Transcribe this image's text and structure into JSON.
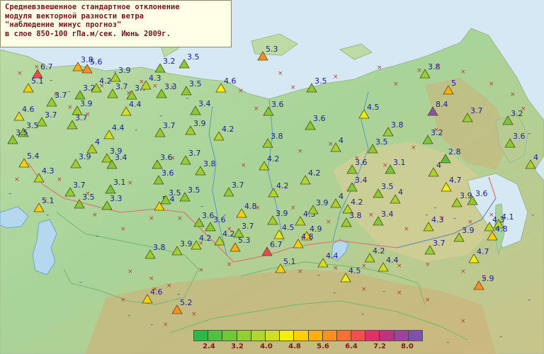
{
  "title": {
    "lines": [
      "Средневзвешенное стандартное отклонение",
      "модуля векторной разности ветра",
      "\"наблюдение минус прогноз\"",
      "в слое 850-100 гПа.м/сек. Июнь 2009г."
    ]
  },
  "legend": {
    "colors": [
      "#2db84a",
      "#4fc040",
      "#70c838",
      "#90d030",
      "#b0d828",
      "#d0e020",
      "#f0f000",
      "#ffd000",
      "#ffb000",
      "#ff9020",
      "#ff7030",
      "#f05050",
      "#e03068",
      "#c03080",
      "#a040a0",
      "#8050b0"
    ],
    "labels": [
      "2.4",
      "3.2",
      "4.0",
      "4.8",
      "5.6",
      "6.4",
      "7.2",
      "8.0"
    ]
  },
  "stations": [
    {
      "v": "6.7",
      "c": "#f04858"
    },
    {
      "v": "3.8",
      "c": "#ffb000"
    },
    {
      "v": "5.6",
      "c": "#ff9020"
    },
    {
      "v": "3.9",
      "c": "#a8d428"
    },
    {
      "v": "3.2",
      "c": "#80cc34"
    },
    {
      "v": "3.5",
      "c": "#88cc30"
    },
    {
      "v": "5.3",
      "c": "#ff9020"
    },
    {
      "v": "5.1",
      "c": "#ffd000"
    },
    {
      "v": "3.7",
      "c": "#90d030"
    },
    {
      "v": "3.2",
      "c": "#78c838"
    },
    {
      "v": "4.2",
      "c": "#a8d428"
    },
    {
      "v": "3.7",
      "c": "#90d030"
    },
    {
      "v": "3.7",
      "c": "#90d030"
    },
    {
      "v": "4.3",
      "c": "#b8d828"
    },
    {
      "v": "3.3",
      "c": "#80cc34"
    },
    {
      "v": "3.5",
      "c": "#88cc30"
    },
    {
      "v": "4.6",
      "c": "#ffee00"
    },
    {
      "v": "3.5",
      "c": "#88cc30"
    },
    {
      "v": "3.8",
      "c": "#98d030"
    },
    {
      "v": "5",
      "c": "#ffb000"
    },
    {
      "v": "4.6",
      "c": "#d8e020"
    },
    {
      "v": "3.7",
      "c": "#90d030"
    },
    {
      "v": "3.9",
      "c": "#a0d02c"
    },
    {
      "v": "4.4",
      "c": "#d0e020"
    },
    {
      "v": "3.4",
      "c": "#80cc34"
    },
    {
      "v": "3.6",
      "c": "#88cc30"
    },
    {
      "v": "4.5",
      "c": "#e8ec10"
    },
    {
      "v": "8.4",
      "c": "#9050a8"
    },
    {
      "v": "3.7",
      "c": "#90d030"
    },
    {
      "v": "3.2",
      "c": "#78c838"
    },
    {
      "v": "3.5",
      "c": "#88cc30"
    },
    {
      "v": "3.7",
      "c": "#90d030"
    },
    {
      "v": "4.4",
      "c": "#d0e020"
    },
    {
      "v": "3.7",
      "c": "#90d030"
    },
    {
      "v": "3.9",
      "c": "#a0d02c"
    },
    {
      "v": "3.6",
      "c": "#88cc30"
    },
    {
      "v": "3.5",
      "c": "#88cc30"
    },
    {
      "v": "3.2",
      "c": "#78c838"
    },
    {
      "v": "3.6",
      "c": "#88cc30"
    },
    {
      "v": "3.5",
      "c": "#88cc30"
    },
    {
      "v": "4.2",
      "c": "#b0d828"
    },
    {
      "v": "3.8",
      "c": "#98d030"
    },
    {
      "v": "4",
      "c": "#a8d428"
    },
    {
      "v": "3.8",
      "c": "#98d030"
    },
    {
      "v": "2.8",
      "c": "#58c03c"
    },
    {
      "v": "4",
      "c": "#a8d428"
    },
    {
      "v": "5.4",
      "c": "#ffd000"
    },
    {
      "v": "3.9",
      "c": "#a0d02c"
    },
    {
      "v": "3.9",
      "c": "#a0d02c"
    },
    {
      "v": "3.4",
      "c": "#80cc34"
    },
    {
      "v": "3.6",
      "c": "#88cc30"
    },
    {
      "v": "3.7",
      "c": "#90d030"
    },
    {
      "v": "4.2",
      "c": "#b0d828"
    },
    {
      "v": "3.6",
      "c": "#88cc30"
    },
    {
      "v": "3.1",
      "c": "#70c838"
    },
    {
      "v": "4",
      "c": "#a8d428"
    },
    {
      "v": "4.3",
      "c": "#b8d828"
    },
    {
      "v": "4",
      "c": "#a8d428"
    },
    {
      "v": "3.6",
      "c": "#88cc30"
    },
    {
      "v": "3.8",
      "c": "#98d030"
    },
    {
      "v": "4.2",
      "c": "#b0d828"
    },
    {
      "v": "4.7",
      "c": "#f0f000"
    },
    {
      "v": "3.7",
      "c": "#90d030"
    },
    {
      "v": "3.1",
      "c": "#70c838"
    },
    {
      "v": "3.5",
      "c": "#88cc30"
    },
    {
      "v": "3.7",
      "c": "#90d030"
    },
    {
      "v": "4.2",
      "c": "#b0d828"
    },
    {
      "v": "3.4",
      "c": "#80cc34"
    },
    {
      "v": "3.5",
      "c": "#88cc30"
    },
    {
      "v": "4",
      "c": "#a8d428"
    },
    {
      "v": "3.9",
      "c": "#a0d02c"
    },
    {
      "v": "5.1",
      "c": "#ffd000"
    },
    {
      "v": "3.5",
      "c": "#88cc30"
    },
    {
      "v": "3.3",
      "c": "#80cc34"
    },
    {
      "v": "5.4",
      "c": "#ffd000"
    },
    {
      "v": "3.5",
      "c": "#88cc30"
    },
    {
      "v": "4.8",
      "c": "#ffd000"
    },
    {
      "v": "3.6",
      "c": "#88cc30"
    },
    {
      "v": "3.9",
      "c": "#a0d02c"
    },
    {
      "v": "4.3",
      "c": "#b8d828"
    },
    {
      "v": "4",
      "c": "#a8d428"
    },
    {
      "v": "3.6",
      "c": "#88cc30"
    },
    {
      "v": "4.2",
      "c": "#b0d828"
    },
    {
      "v": "3.7",
      "c": "#90d030"
    },
    {
      "v": "3.9",
      "c": "#a0d02c"
    },
    {
      "v": "4.2",
      "c": "#b0d828"
    },
    {
      "v": "3.8",
      "c": "#98d030"
    },
    {
      "v": "3.4",
      "c": "#80cc34"
    },
    {
      "v": "4.3",
      "c": "#b8d828"
    },
    {
      "v": "3.6",
      "c": "#88cc30"
    },
    {
      "v": "4.1",
      "c": "#b0d828"
    },
    {
      "v": "4.5",
      "c": "#e8ec10"
    },
    {
      "v": "4.9",
      "c": "#ffd000"
    },
    {
      "v": "4.3",
      "c": "#b8d828"
    },
    {
      "v": "3.9",
      "c": "#a0d02c"
    },
    {
      "v": "4.8",
      "c": "#ffd000"
    },
    {
      "v": "3.8",
      "c": "#98d030"
    },
    {
      "v": "3.9",
      "c": "#a0d02c"
    },
    {
      "v": "4.2",
      "c": "#b0d828"
    },
    {
      "v": "5.3",
      "c": "#ffb000"
    },
    {
      "v": "6.7",
      "c": "#f04858"
    },
    {
      "v": "4.8",
      "c": "#ffd000"
    },
    {
      "v": "3.7",
      "c": "#90d030"
    },
    {
      "v": "5.1",
      "c": "#ffd000"
    },
    {
      "v": "4.4",
      "c": "#d0e020"
    },
    {
      "v": "4.2",
      "c": "#b0d828"
    },
    {
      "v": "4.4",
      "c": "#d0e020"
    },
    {
      "v": "4.7",
      "c": "#f0f000"
    },
    {
      "v": "4.5",
      "c": "#e8ec10"
    },
    {
      "v": "5.9",
      "c": "#ff9020"
    },
    {
      "v": "4.6",
      "c": "#ffd000"
    },
    {
      "v": "5.2",
      "c": "#ff9020"
    }
  ]
}
